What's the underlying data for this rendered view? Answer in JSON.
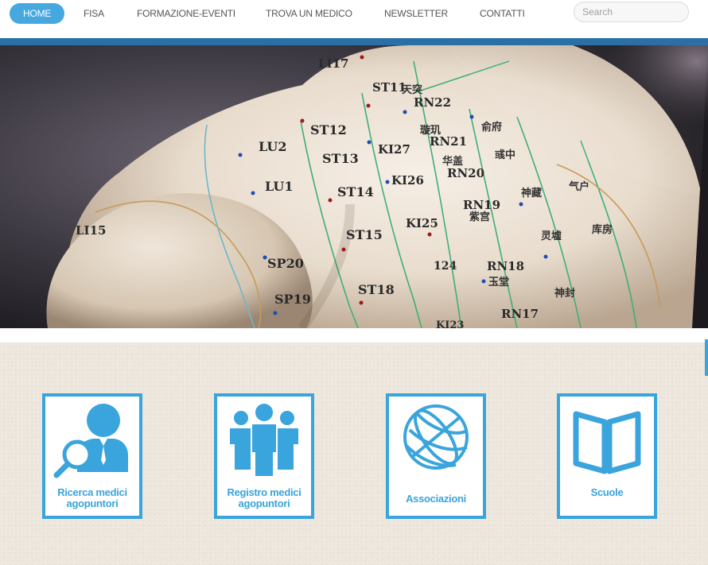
{
  "nav": {
    "items": [
      {
        "label": "HOME",
        "active": true
      },
      {
        "label": "FISA"
      },
      {
        "label": "FORMAZIONE-EVENTI"
      },
      {
        "label": "TROVA UN MEDICO"
      },
      {
        "label": "NEWSLETTER"
      },
      {
        "label": "CONTATTI"
      }
    ],
    "search_placeholder": "Search"
  },
  "hero": {
    "labels": [
      "LI17",
      "ST11",
      "RN22",
      "ST12",
      "LU2",
      "ST13",
      "KI27",
      "RN21",
      "LU1",
      "ST14",
      "KI26",
      "RN20",
      "RN19",
      "LI15",
      "ST15",
      "KI25",
      "SP20",
      "124",
      "RN18",
      "SP19",
      "ST18",
      "RN17",
      "KI23"
    ]
  },
  "tiles": [
    {
      "label": "Ricerca medici\nagopuntori",
      "icon": "search-doctor-icon"
    },
    {
      "label": "Registro medici\nagopuntori",
      "icon": "people-registry-icon"
    },
    {
      "label": "Associazioni",
      "icon": "globe-icon"
    },
    {
      "label": "Scuole",
      "icon": "open-book-icon"
    }
  ],
  "colors": {
    "accent": "#3aa4dc",
    "nav_active": "#45a9e0",
    "strip": "#2a6fa6",
    "tiles_background": "#ece6dc"
  }
}
